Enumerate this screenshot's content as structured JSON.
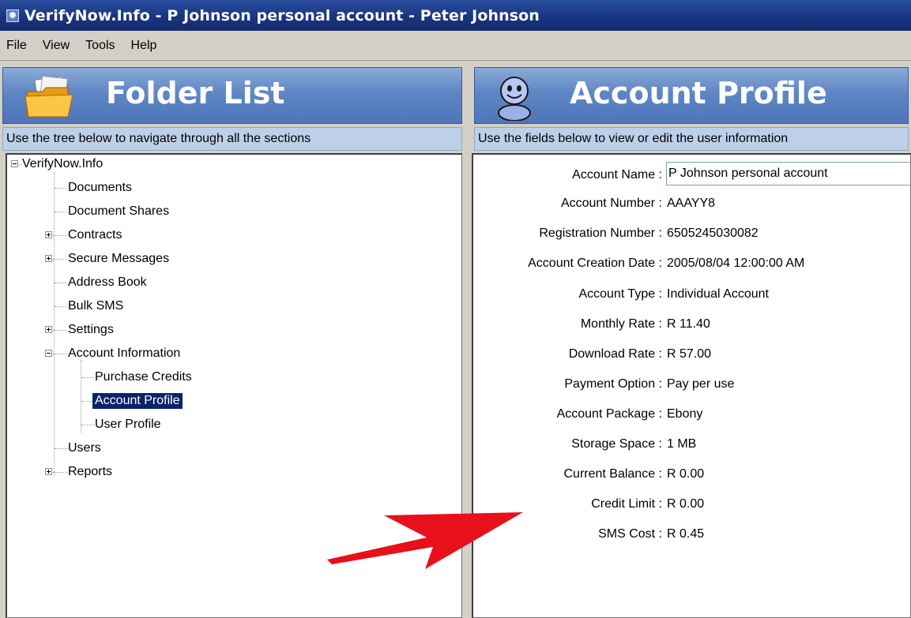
{
  "window": {
    "title": "VerifyNow.Info - P Johnson personal account - Peter Johnson"
  },
  "menubar": {
    "items": [
      "File",
      "View",
      "Tools",
      "Help"
    ]
  },
  "folder_panel": {
    "title": "Folder List",
    "subtitle": "Use the tree below to navigate through all the sections",
    "tree": [
      {
        "label": "VerifyNow.Info",
        "toggle": "minus"
      },
      {
        "label": "Documents"
      },
      {
        "label": "Document Shares"
      },
      {
        "label": "Contracts",
        "toggle": "plus"
      },
      {
        "label": "Secure Messages",
        "toggle": "plus"
      },
      {
        "label": "Address Book"
      },
      {
        "label": "Bulk SMS"
      },
      {
        "label": "Settings",
        "toggle": "plus"
      },
      {
        "label": "Account Information",
        "toggle": "minus"
      },
      {
        "label": "Purchase Credits"
      },
      {
        "label": "Account Profile",
        "selected": true
      },
      {
        "label": "User Profile"
      },
      {
        "label": "Users"
      },
      {
        "label": "Reports",
        "toggle": "plus"
      }
    ]
  },
  "profile_panel": {
    "title": "Account Profile",
    "subtitle": "Use the fields below to view or edit the user information",
    "fields": [
      {
        "label": "Account Name :",
        "value": "P Johnson personal account"
      },
      {
        "label": "Account Number :",
        "value": "AAAYY8"
      },
      {
        "label": "Registration Number :",
        "value": "6505245030082"
      },
      {
        "label": "Account Creation Date :",
        "value": "2005/08/04 12:00:00 AM"
      },
      {
        "label": "Account Type :",
        "value": "Individual Account"
      },
      {
        "label": "Monthly Rate :",
        "value": "R 11.40"
      },
      {
        "label": "Download Rate :",
        "value": "R 57.00"
      },
      {
        "label": "Payment Option :",
        "value": "Pay per use"
      },
      {
        "label": "Account Package :",
        "value": "Ebony"
      },
      {
        "label": "Storage Space :",
        "value": "1 MB"
      },
      {
        "label": "Current Balance :",
        "value": "R 0.00"
      },
      {
        "label": "Credit Limit :",
        "value": "R 0.00"
      },
      {
        "label": "SMS Cost :",
        "value": "R 0.45"
      }
    ]
  },
  "annotation": {
    "color": "#e8101a",
    "icon": "red-arrow"
  }
}
